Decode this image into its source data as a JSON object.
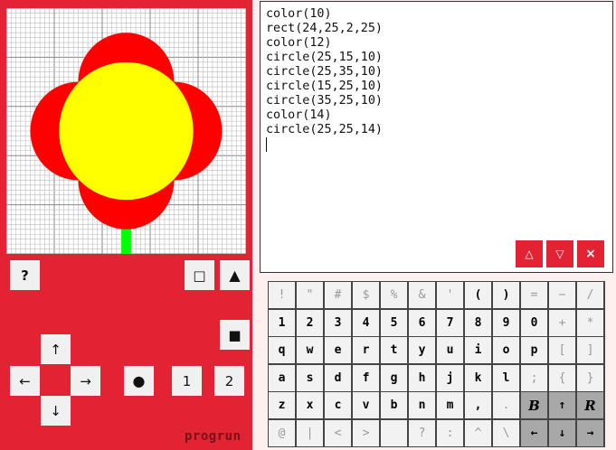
{
  "app": {
    "brand": "progrun"
  },
  "screen": {
    "grid_cells": 50,
    "colors": {
      "red": "#ff0000",
      "yellow": "#ffff00",
      "green": "#00ff00",
      "grid": "#aaaaaa"
    }
  },
  "device_keys": {
    "help": "?",
    "square_outline": "□",
    "triangle": "▲",
    "square_filled": "■",
    "up": "↑",
    "left": "←",
    "right": "→",
    "down": "↓",
    "circle": "●",
    "one": "1",
    "two": "2"
  },
  "editor": {
    "lines": [
      "color(10)",
      "rect(24,25,2,25)",
      "color(12)",
      "circle(25,15,10)",
      "circle(25,35,10)",
      "circle(15,25,10)",
      "circle(35,25,10)",
      "color(14)",
      "circle(25,25,14)"
    ],
    "buttons": {
      "up": "△",
      "down": "▽",
      "close": "×"
    },
    "accent": "#e12334"
  },
  "keyboard": {
    "rows": [
      [
        "!",
        "\"",
        "#",
        "$",
        "%",
        "&",
        "'",
        "(",
        ")",
        "=",
        "−",
        "/"
      ],
      [
        "1",
        "2",
        "3",
        "4",
        "5",
        "6",
        "7",
        "8",
        "9",
        "0",
        "+",
        "*"
      ],
      [
        "q",
        "w",
        "e",
        "r",
        "t",
        "y",
        "u",
        "i",
        "o",
        "p",
        "[",
        "]"
      ],
      [
        "a",
        "s",
        "d",
        "f",
        "g",
        "h",
        "j",
        "k",
        "l",
        ";",
        "{",
        "}"
      ],
      [
        "z",
        "x",
        "c",
        "v",
        "b",
        "n",
        "m",
        ",",
        ".",
        "B",
        "↑",
        "R"
      ],
      [
        "@",
        "|",
        "<",
        ">",
        "",
        "?",
        ":",
        "^",
        "\\",
        "←",
        "↓",
        "→"
      ]
    ]
  }
}
